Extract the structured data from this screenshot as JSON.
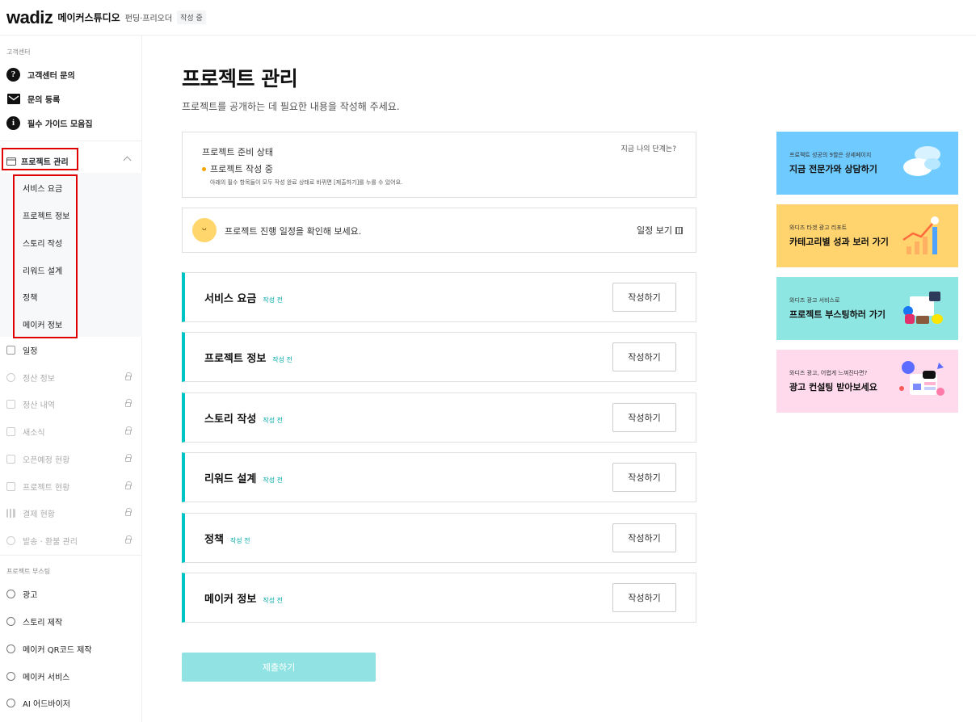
{
  "header": {
    "logo": "wadiz",
    "studio": "메이커스튜디오",
    "breadcrumb": "펀딩·프리오더",
    "badge": "작성 중"
  },
  "sidebar": {
    "support_title": "고객센터",
    "support_items": [
      "고객센터 문의",
      "문의 등록",
      "필수 가이드 모음집"
    ],
    "project_mgmt": "프로젝트 관리",
    "project_subitems": [
      "서비스 요금",
      "프로젝트 정보",
      "스토리 작성",
      "리워드 설계",
      "정책",
      "메이커 정보"
    ],
    "schedule": "일정",
    "locked_items": [
      "정산 정보",
      "정산 내역",
      "새소식",
      "오픈예정 현황",
      "프로젝트 현황",
      "결제 현황",
      "발송 · 환불 관리"
    ],
    "boost_title": "프로젝트 부스팅",
    "boost_items": [
      "광고",
      "스토리 제작",
      "메이커 QR코드 제작",
      "메이커 서비스",
      "AI 어드바이저"
    ]
  },
  "main": {
    "title": "프로젝트 관리",
    "description": "프로젝트를 공개하는 데 필요한 내용을 작성해 주세요.",
    "status_card": {
      "title": "프로젝트 준비 상태",
      "help_link": "지금 나의 단계는?",
      "state": "프로젝트 작성 중",
      "note": "아래의 필수 항목들이 모두 작성 완료 상태로 바뀌면 [제출하기]를 누를 수 있어요."
    },
    "schedule_card": {
      "text": "프로젝트 진행 일정을 확인해 보세요.",
      "link": "일정 보기"
    },
    "tasks": [
      {
        "name": "서비스 요금",
        "status": "작성 전",
        "button": "작성하기"
      },
      {
        "name": "프로젝트 정보",
        "status": "작성 전",
        "button": "작성하기"
      },
      {
        "name": "스토리 작성",
        "status": "작성 전",
        "button": "작성하기"
      },
      {
        "name": "리워드 설계",
        "status": "작성 전",
        "button": "작성하기"
      },
      {
        "name": "정책",
        "status": "작성 전",
        "button": "작성하기"
      },
      {
        "name": "메이커 정보",
        "status": "작성 전",
        "button": "작성하기"
      }
    ],
    "submit": "제출하기"
  },
  "banners": [
    {
      "sub": "프로젝트 성공의 9할은 상세페이지",
      "main": "지금 전문가와 상담하기"
    },
    {
      "sub": "와디즈 타겟 광고 리포트",
      "main": "카테고리별 성과 보러 가기"
    },
    {
      "sub": "와디즈 광고 서비스로",
      "main": "프로젝트 부스팅하러 가기"
    },
    {
      "sub": "와디즈 광고, 어렵게 느껴진다면?",
      "main": "광고 컨설팅 받아보세요"
    }
  ],
  "colors": {
    "accent": "#00c4c4",
    "highlight_box": "#e10000",
    "status_dot": "#f5a300"
  }
}
